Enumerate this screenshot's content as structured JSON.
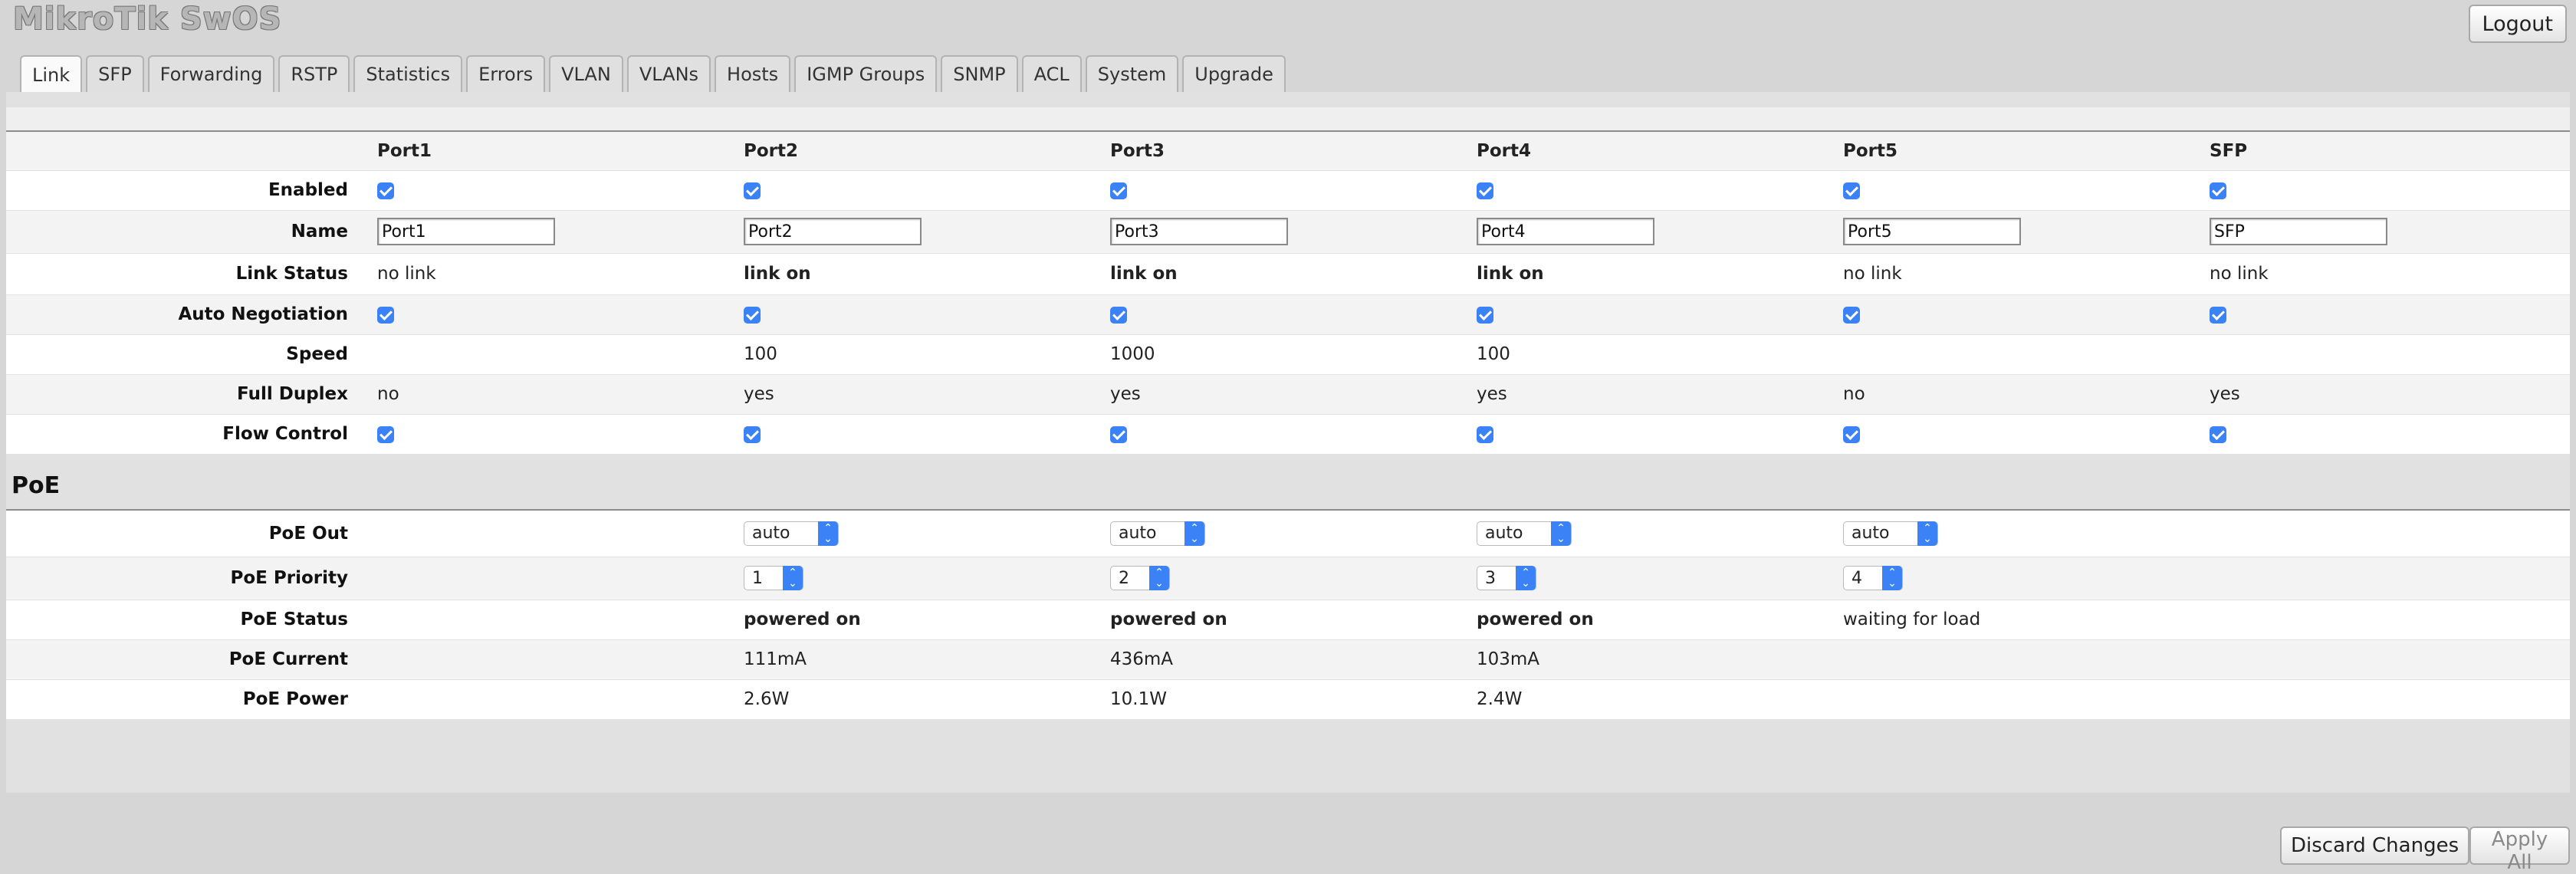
{
  "app": {
    "title": "MikroTik SwOS",
    "logout_label": "Logout"
  },
  "tabs": [
    "Link",
    "SFP",
    "Forwarding",
    "RSTP",
    "Statistics",
    "Errors",
    "VLAN",
    "VLANs",
    "Hosts",
    "IGMP Groups",
    "SNMP",
    "ACL",
    "System",
    "Upgrade"
  ],
  "active_tab": "Link",
  "ports": [
    "Port1",
    "Port2",
    "Port3",
    "Port4",
    "Port5",
    "SFP"
  ],
  "link": {
    "labels": {
      "enabled": "Enabled",
      "name": "Name",
      "link_status": "Link Status",
      "auto_negotiation": "Auto Negotiation",
      "speed": "Speed",
      "full_duplex": "Full Duplex",
      "flow_control": "Flow Control"
    },
    "enabled": [
      true,
      true,
      true,
      true,
      true,
      true
    ],
    "names": [
      "Port1",
      "Port2",
      "Port3",
      "Port4",
      "Port5",
      "SFP"
    ],
    "link_status": [
      "no link",
      "link on",
      "link on",
      "link on",
      "no link",
      "no link"
    ],
    "auto_negotiation": [
      true,
      true,
      true,
      true,
      true,
      true
    ],
    "speed": [
      "",
      "100",
      "1000",
      "100",
      "",
      ""
    ],
    "full_duplex": [
      "no",
      "yes",
      "yes",
      "yes",
      "no",
      "yes"
    ],
    "flow_control": [
      true,
      true,
      true,
      true,
      true,
      true
    ]
  },
  "poe": {
    "title": "PoE",
    "labels": {
      "out": "PoE Out",
      "priority": "PoE Priority",
      "status": "PoE Status",
      "current": "PoE Current",
      "power": "PoE Power"
    },
    "out": [
      "",
      "auto",
      "auto",
      "auto",
      "auto",
      ""
    ],
    "priority": [
      "",
      "1",
      "2",
      "3",
      "4",
      ""
    ],
    "status": [
      "",
      "powered on",
      "powered on",
      "powered on",
      "waiting for load",
      ""
    ],
    "current": [
      "",
      "111mA",
      "436mA",
      "103mA",
      "",
      ""
    ],
    "power": [
      "",
      "2.6W",
      "10.1W",
      "2.4W",
      "",
      ""
    ]
  },
  "buttons": {
    "discard": "Discard Changes",
    "apply": "Apply All"
  },
  "colors": {
    "accent": "#3b82f6"
  }
}
